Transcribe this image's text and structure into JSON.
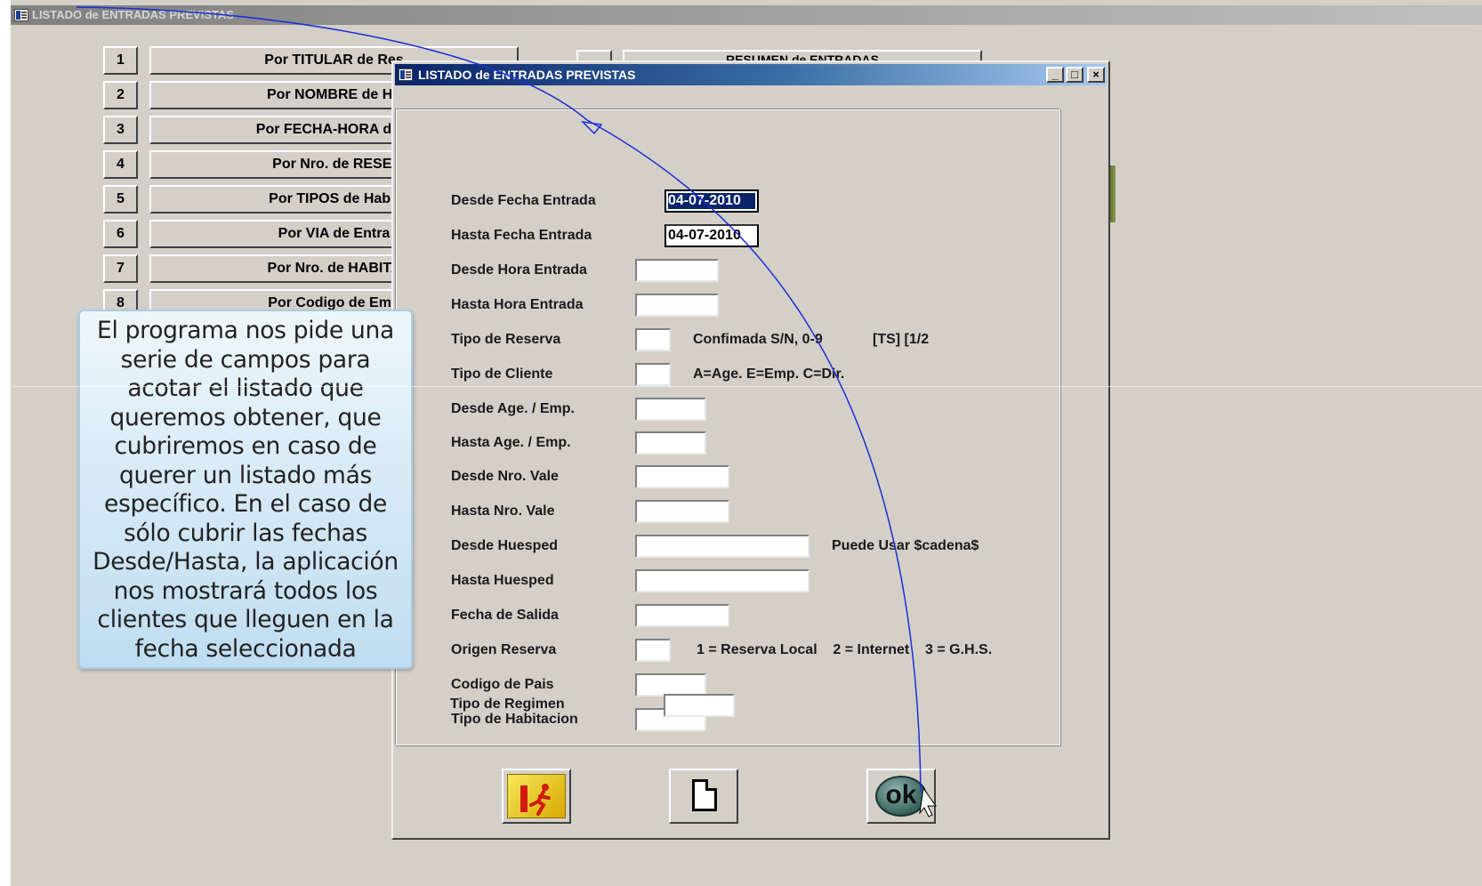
{
  "background_window": {
    "title": "LISTADO de ENTRADAS PREVISTAS",
    "menu_numbers": [
      "1",
      "2",
      "3",
      "4",
      "5",
      "6",
      "7",
      "8"
    ],
    "menu_items": [
      "Por TITULAR de Res",
      "Por NOMBRE de Hu",
      "Por FECHA-HORA de L",
      "Por Nro. de RESEI",
      "Por TIPOS de Habit",
      "Por VIA de Entra",
      "Por Nro. de HABITA",
      "Por Codigo de Emp"
    ],
    "top_right_button": "RESUMEN de ENTRADAS"
  },
  "dialog": {
    "title": "LISTADO de ENTRADAS PREVISTAS",
    "caption_buttons": {
      "minimize": "_",
      "maximize": "□",
      "close": "×"
    },
    "fields": [
      {
        "label": "Desde Fecha Entrada",
        "value": "04-07-2010",
        "selected": true
      },
      {
        "label": "Hasta Fecha Entrada",
        "value": "04-07-2010"
      },
      {
        "label": "Desde Hora Entrada",
        "value": ""
      },
      {
        "label": "Hasta Hora Entrada",
        "value": ""
      },
      {
        "label": "Tipo de Reserva",
        "value": "",
        "hint": "Confimada S/N, 0-9",
        "hint2": "[TS] [1/2"
      },
      {
        "label": "Tipo de Cliente",
        "value": "",
        "hint": "A=Age. E=Emp. C=Dir."
      },
      {
        "label": "Desde  Age. / Emp.",
        "value": ""
      },
      {
        "label": "Hasta  Age. / Emp.",
        "value": ""
      },
      {
        "label": "Desde Nro. Vale",
        "value": ""
      },
      {
        "label": "Hasta Nro. Vale",
        "value": ""
      },
      {
        "label": "Desde  Huesped",
        "value": "",
        "hint": "Puede Usar  $cadena$"
      },
      {
        "label": "Hasta  Huesped",
        "value": ""
      },
      {
        "label": "Fecha de Salida",
        "value": ""
      },
      {
        "label": "Origen Reserva",
        "value": "",
        "hint": "1 = Reserva Local    2 = Internet    3 = G.H.S."
      },
      {
        "label": "Codigo de Pais",
        "value": ""
      },
      {
        "label": "Tipo de Habitacion",
        "value": ""
      },
      {
        "label": "Tipo de Regimen",
        "value": ""
      }
    ],
    "buttons": {
      "exit_icon": "exit-door-running-icon",
      "new_icon": "blank-page-icon",
      "ok_label": "ok"
    }
  },
  "callout": {
    "text": "El programa nos pide una serie de campos para acotar el listado que queremos obtener, que cubriremos en caso de querer un listado más específico. En el caso de sólo cubrir las fechas Desde/Hasta, la aplicación nos mostrará todos los clientes que lleguen en la fecha seleccionada"
  },
  "colors": {
    "window_bg": "#d4d0c8",
    "active_title": "#0a246a",
    "selection": "#0a246a",
    "annotation_line": "#1a2fd6",
    "callout_fill": "#cfe6f5"
  }
}
